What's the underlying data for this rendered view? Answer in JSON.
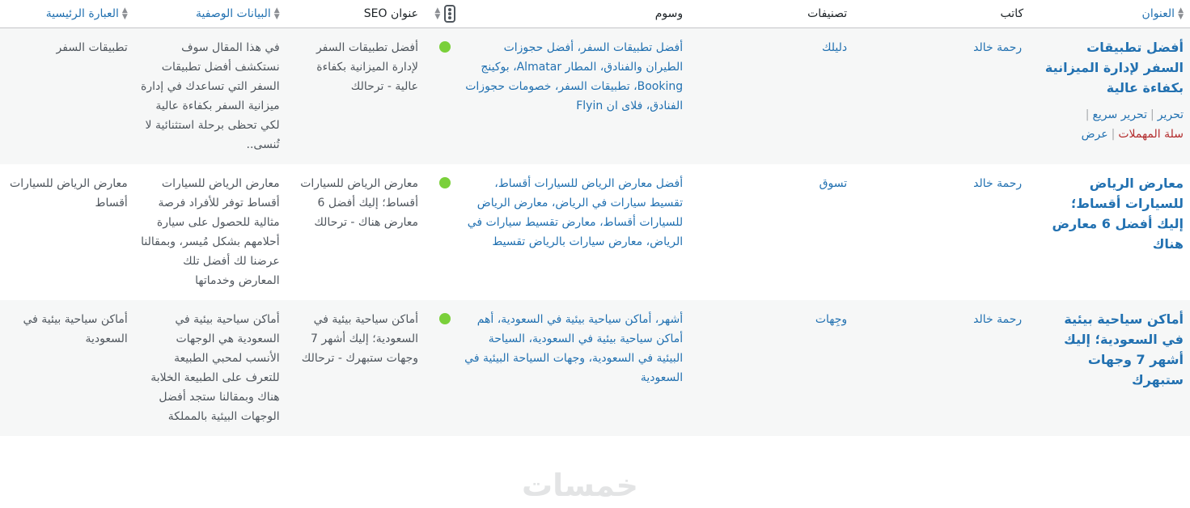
{
  "columns": {
    "title": "العنوان",
    "author": "كاتب",
    "categories": "تصنيفات",
    "tags": "وسوم",
    "seo_title": "عنوان SEO",
    "meta_desc": "البيانات الوصفية",
    "keyphrase": "العبارة الرئيسية"
  },
  "row_actions": {
    "edit": "تحرير",
    "quick_edit": "تحرير سريع",
    "trash": "سلة المهملات",
    "view": "عرض"
  },
  "rows": [
    {
      "title": "أفضل تطبيقات السفر لإدارة الميزانية بكفاءة عالية",
      "author": "رحمة خالد",
      "category": "دليلك",
      "tags": "أفضل تطبيقات السفر، أفضل حجوزات الطيران والفنادق، المطار Almatar، بوكينج Booking، تطبيقات السفر، خصومات حجوزات الفنادق، فلاى ان Flyin",
      "seo_title": "أفضل تطبيقات السفر لإدارة الميزانية بكفاءة عالية - ترحالك",
      "meta_desc": "في هذا المقال سوف نستكشف أفضل تطبيقات السفر التي تساعدك في إدارة ميزانية السفر بكفاءة عالية لكي تحظى برحلة استثنائية لا تُنسى..",
      "keyphrase": "تطبيقات السفر"
    },
    {
      "title": "معارض الرياض للسيارات أقساط؛ إليك أفضل 6 معارض هناك",
      "author": "رحمة خالد",
      "category": "تسوق",
      "tags": "أفضل معارض الرياض للسيارات أقساط، تقسيط سيارات في الرياض، معارض الرياض للسيارات أقساط، معارض تقسيط سيارات في الرياض، معارض سيارات بالرياض تقسيط",
      "seo_title": "معارض الرياض للسيارات أقساط؛ إليك أفضل 6 معارض هناك - ترحالك",
      "meta_desc": "معارض الرياض للسيارات أقساط توفر للأفراد فرصة مثالية للحصول على سيارة أحلامهم بشكل مُيسر، وبمقالنا عرضنا لك أفضل تلك المعارض وخدماتها",
      "keyphrase": "معارض الرياض للسيارات أقساط"
    },
    {
      "title": "أماكن سياحية بيئية في السعودية؛ إليك أشهر 7 وجهات ستبهرك",
      "author": "رحمة خالد",
      "category": "وجِهات",
      "tags": "أشهر، أماكن سياحية بيئية في السعودية، أهم أماكن سياحية بيئية في السعودية، السياحة البيئية في السعودية، وجهات السياحة البيئية في السعودية",
      "seo_title": "أماكن سياحية بيئية في السعودية؛ إليك أشهر 7 وجهات ستبهرك - ترحالك",
      "meta_desc": "أماكن سياحية بيئية في السعودية هي الوجهات الأنسب لمحبي الطبيعة للتعرف على الطبيعة الخلابة هناك وبمقالنا ستجد أفضل الوجهات البيئية بالمملكة",
      "keyphrase": "أماكن سياحية بيئية في السعودية"
    }
  ],
  "watermark": "خمسات",
  "colors": {
    "link": "#2271b1",
    "seo_dot": "#7ad03a",
    "trash": "#b32d2e"
  }
}
